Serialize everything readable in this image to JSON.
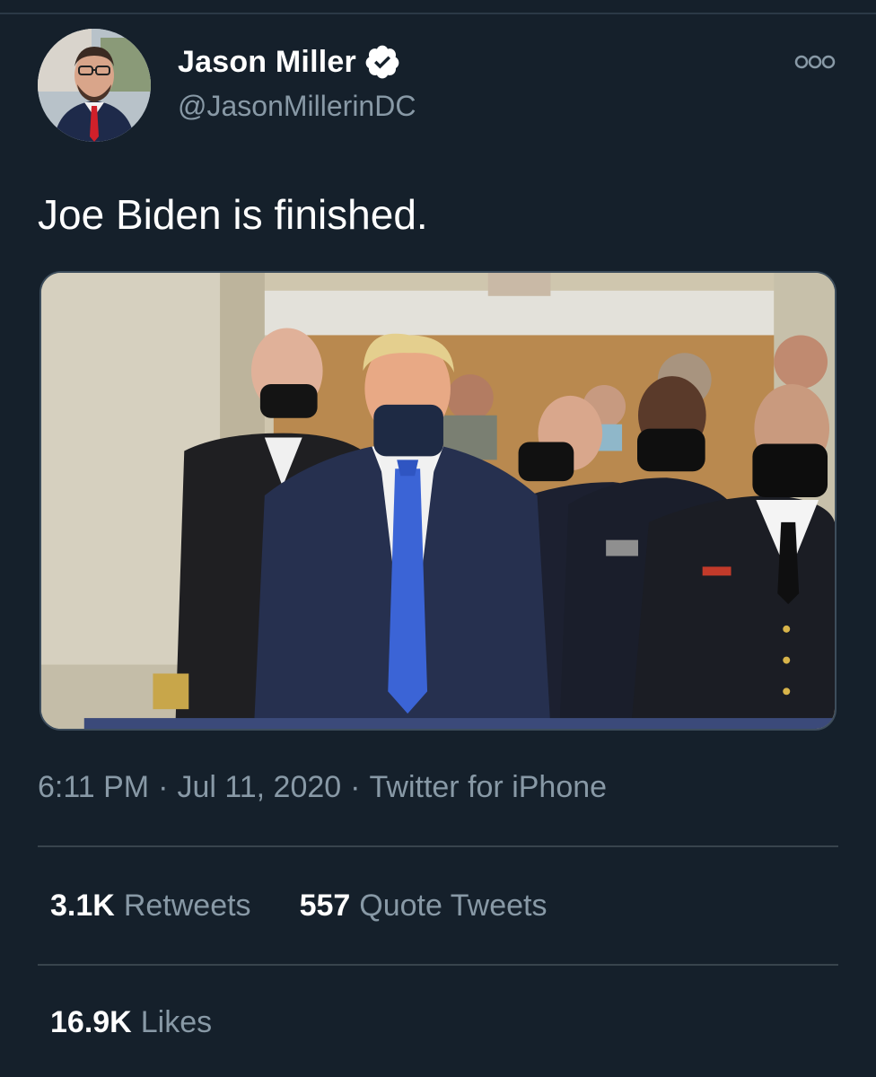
{
  "colors": {
    "background": "#15202b",
    "primary_text": "#ffffff",
    "secondary_text": "#8899a6",
    "divider": "#38444d",
    "verified_badge": "#ffffff"
  },
  "author": {
    "display_name": "Jason Miller",
    "handle": "@JasonMillerinDC",
    "verified": true,
    "avatar_icon": "profile-photo",
    "verified_icon": "verified-badge-icon"
  },
  "actions": {
    "more_icon": "more-options-icon"
  },
  "tweet": {
    "text": "Joe Biden is finished.",
    "media_description_icon": "photo-media"
  },
  "meta": {
    "time": "6:11 PM",
    "separator": "·",
    "date": "Jul 11, 2020",
    "source": "Twitter for iPhone"
  },
  "stats": {
    "retweets_count": "3.1K",
    "retweets_label": "Retweets",
    "quotes_count": "557",
    "quotes_label": "Quote Tweets",
    "likes_count": "16.9K",
    "likes_label": "Likes"
  }
}
